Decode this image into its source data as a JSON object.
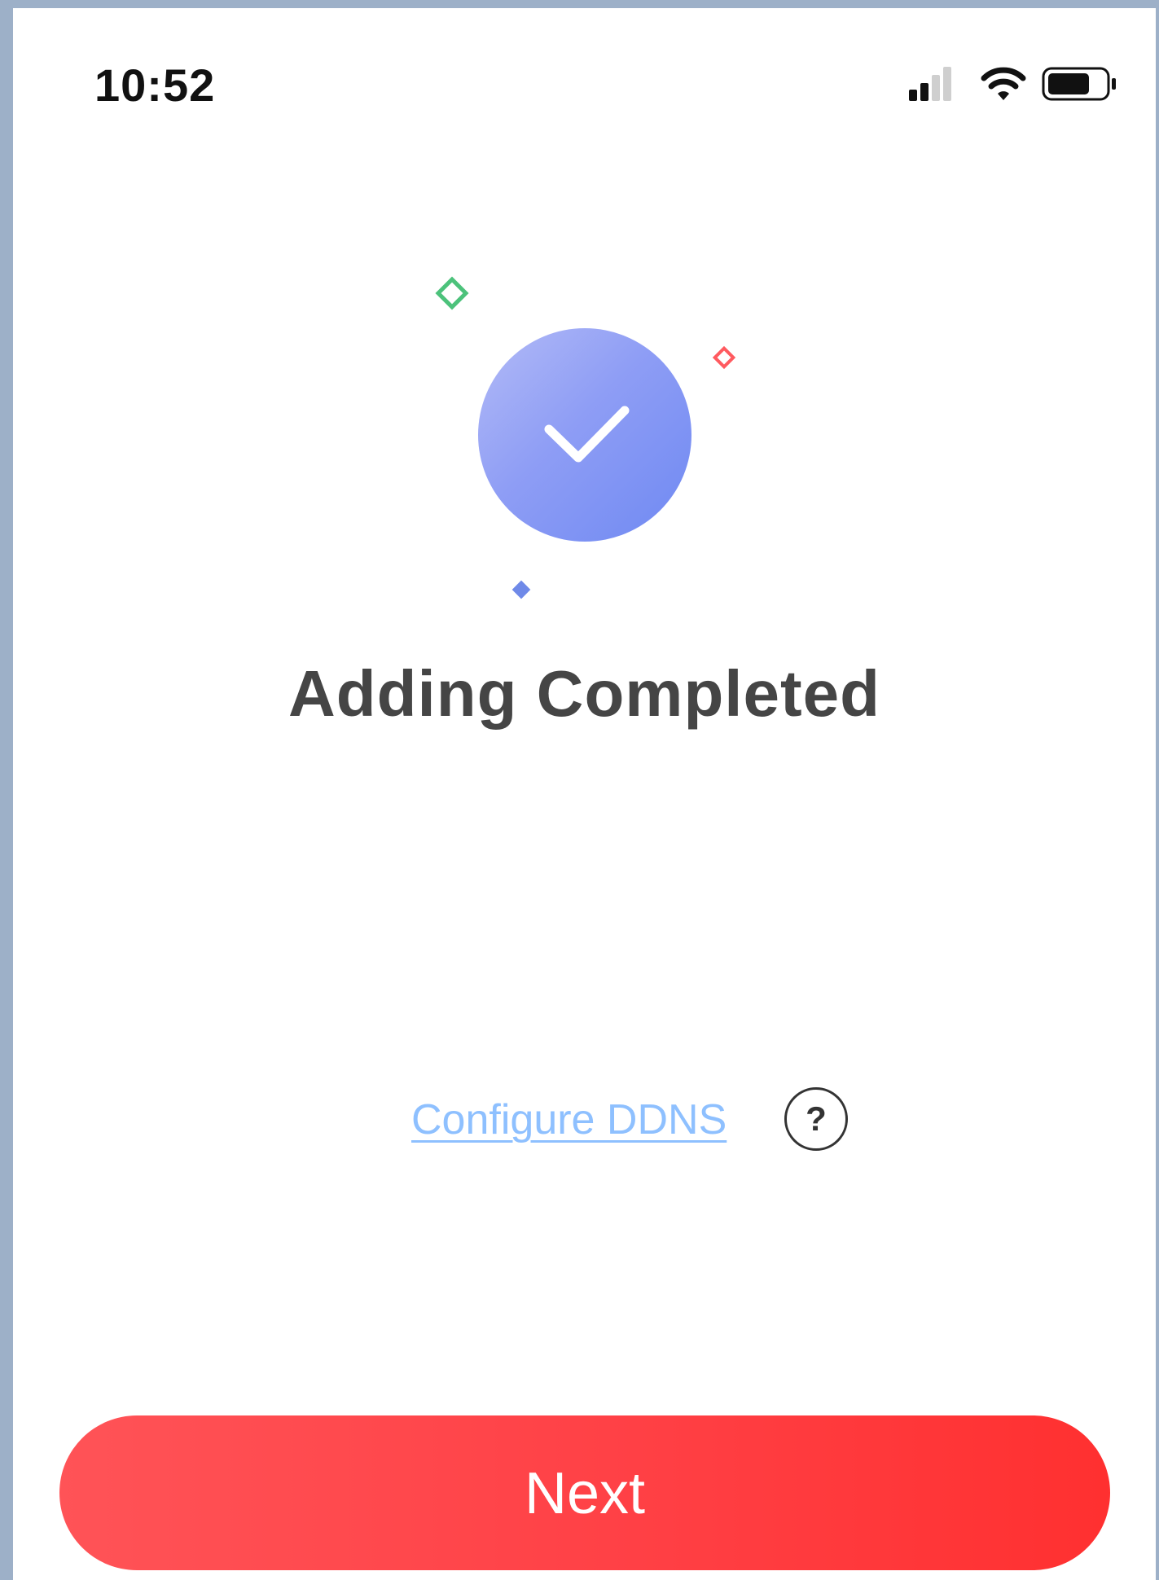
{
  "status_bar": {
    "time": "10:52",
    "icons": [
      "cellular-signal-icon",
      "wifi-icon",
      "battery-icon"
    ]
  },
  "illustration": {
    "icon": "checkmark-icon",
    "circle_gradient": [
      "#b3bbf6",
      "#6f89f2"
    ],
    "sparkle_colors": {
      "green": "#4cc27b",
      "red": "#ff5a5f",
      "blue": "#6f89e8"
    }
  },
  "main": {
    "title": "Adding Completed"
  },
  "ddns": {
    "link_label": "Configure DDNS",
    "help_label": "?"
  },
  "footer": {
    "next_label": "Next",
    "next_color": "#ff4045"
  }
}
